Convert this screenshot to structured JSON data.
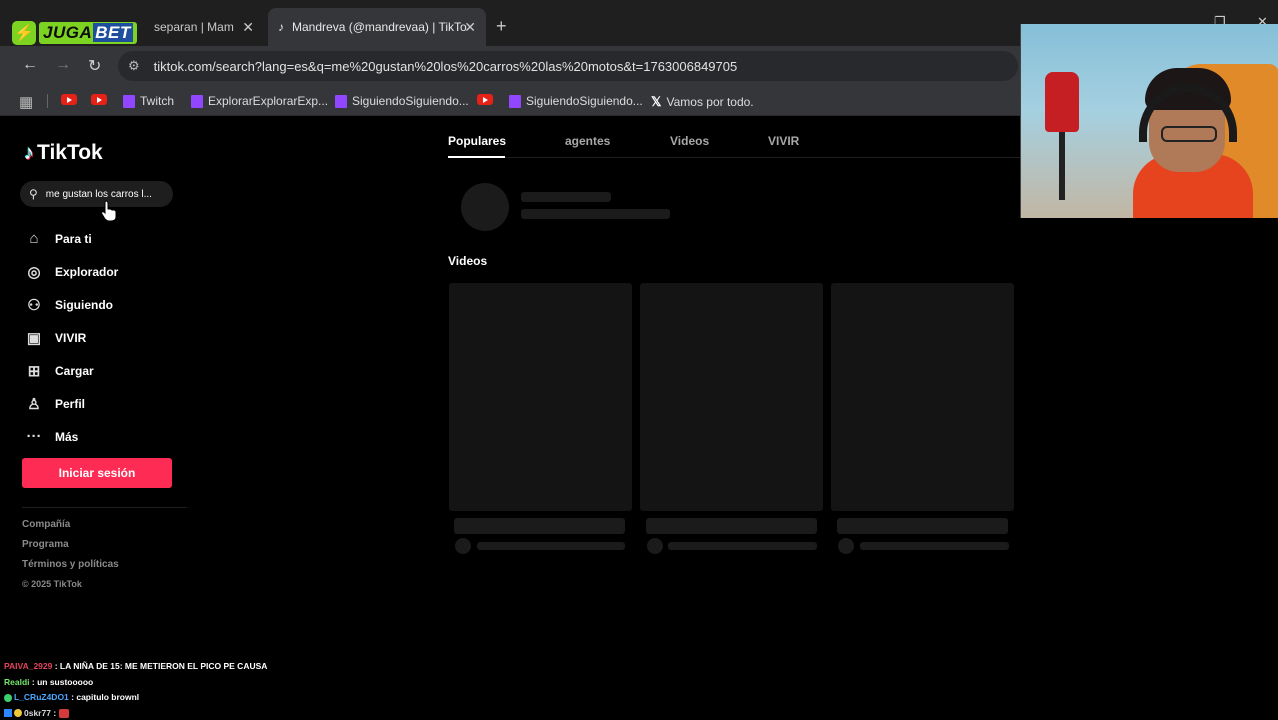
{
  "browser": {
    "tabs": [
      {
        "label": "separan | Mam",
        "active": false
      },
      {
        "label": "Mandreva (@mandrevaa) | TikTo",
        "active": true
      }
    ],
    "new_tab": "+",
    "close_glyph": "✕",
    "url": "tiktok.com/search?lang=es&q=me%20gustan%20los%20carros%20las%20motos&t=1763006849705",
    "bookmarks": [
      {
        "label": "",
        "icon": "youtube-icon"
      },
      {
        "label": "",
        "icon": "youtube-icon"
      },
      {
        "label": "Twitch",
        "icon": "twitch-icon"
      },
      {
        "label": "ExplorarExplorarExp...",
        "icon": "twitch-icon"
      },
      {
        "label": "SiguiendoSiguiendo...",
        "icon": "twitch-icon"
      },
      {
        "label": "",
        "icon": "youtube-icon"
      },
      {
        "label": "SiguiendoSiguiendo...",
        "icon": "twitch-icon"
      },
      {
        "label": "Vamos por todo.",
        "icon": "x-icon"
      }
    ]
  },
  "stream_logo": {
    "text_a": "JUGA",
    "text_b": "BET",
    "bolt": "⚡"
  },
  "tiktok": {
    "logo": "TikTok",
    "search_value": "me gustan los carros l...",
    "nav": [
      {
        "label": "Para ti",
        "icon": "home-icon"
      },
      {
        "label": "Explorador",
        "icon": "compass-icon"
      },
      {
        "label": "Siguiendo",
        "icon": "following-icon"
      },
      {
        "label": "VIVIR",
        "icon": "live-icon"
      },
      {
        "label": "Cargar",
        "icon": "upload-icon"
      },
      {
        "label": "Perfil",
        "icon": "profile-icon"
      },
      {
        "label": "Más",
        "icon": "more-icon"
      }
    ],
    "login_button": "Iniciar sesión",
    "footer": [
      "Compañía",
      "Programa",
      "Términos y políticas",
      "© 2025 TikTok"
    ],
    "content_tabs": [
      "Populares",
      "agentes",
      "Videos",
      "VIVIR"
    ],
    "videos_heading": "Videos"
  },
  "chat": [
    {
      "user": "PAIVA_2929",
      "message": " : LA NIÑA DE 15: ME METIERON EL PICO PE CAUSA"
    },
    {
      "user": "Realdi",
      "message": " : un sustooooo"
    },
    {
      "user": "L_CRuZ4DO1",
      "message": " : capitulo brownl"
    },
    {
      "user": "0skr77",
      "message": " : "
    }
  ],
  "colors": {
    "accent": "#fe2c55",
    "chrome_dark": "#1f1f1f",
    "chrome_mid": "#35363a"
  }
}
